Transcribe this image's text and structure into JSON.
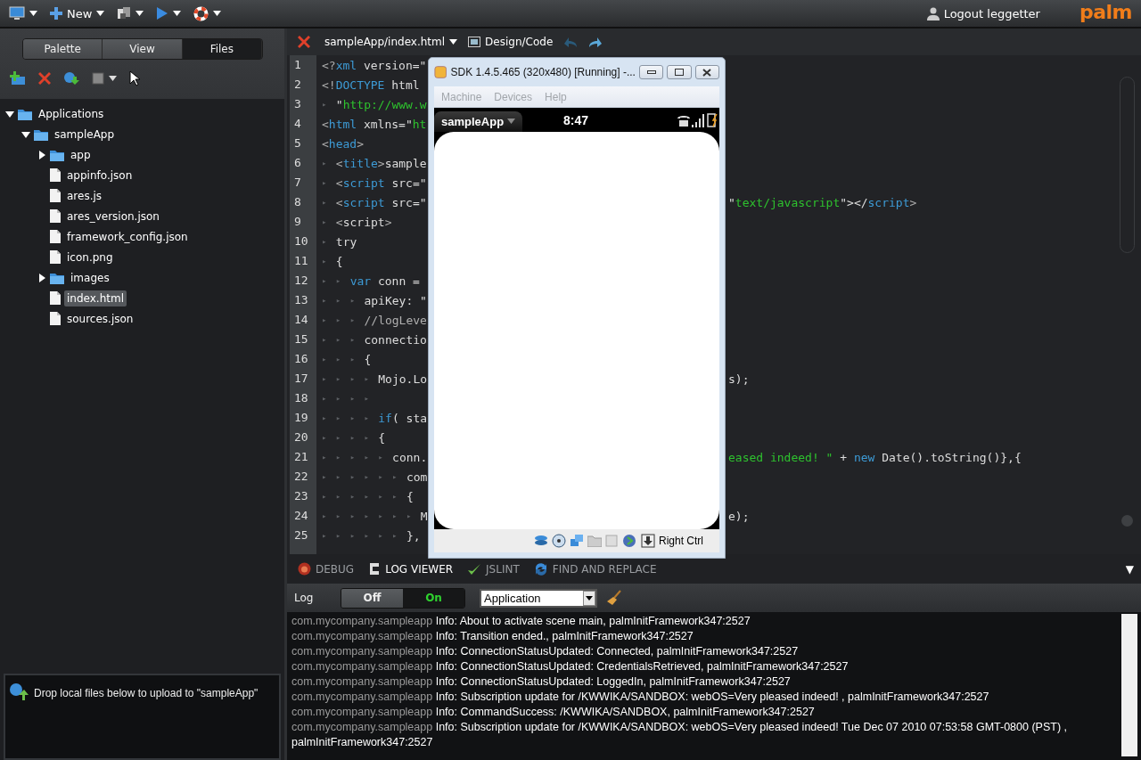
{
  "toolbar": {
    "new_label": "New",
    "user_label": "Logout leggetter",
    "logo": "palm"
  },
  "sidebar": {
    "tabs": [
      {
        "label": "Palette",
        "selected": false
      },
      {
        "label": "View",
        "selected": false
      },
      {
        "label": "Files",
        "selected": true
      }
    ],
    "tree": [
      {
        "label": "Applications",
        "kind": "folder",
        "expanded": true,
        "selected": false,
        "children": [
          {
            "label": "sampleApp",
            "kind": "folder",
            "expanded": true,
            "selected": false,
            "children": [
              {
                "label": "app",
                "kind": "folder",
                "expanded": false,
                "selected": false
              },
              {
                "label": "appinfo.json",
                "kind": "file",
                "selected": false
              },
              {
                "label": "ares.js",
                "kind": "file",
                "selected": false
              },
              {
                "label": "ares_version.json",
                "kind": "file",
                "selected": false
              },
              {
                "label": "framework_config.json",
                "kind": "file",
                "selected": false
              },
              {
                "label": "icon.png",
                "kind": "file",
                "selected": false
              },
              {
                "label": "images",
                "kind": "folder",
                "expanded": false,
                "selected": false
              },
              {
                "label": "index.html",
                "kind": "file",
                "selected": true
              },
              {
                "label": "sources.json",
                "kind": "file",
                "selected": false
              }
            ]
          }
        ]
      }
    ],
    "upload_hint": "Drop local files below to upload to \"sampleApp\""
  },
  "editor": {
    "file_tab": "sampleApp/index.html",
    "mode_label": "Design/Code",
    "lines": [
      {
        "number": "1",
        "left": [
          {
            "kind": "punct",
            "t": "<?"
          },
          {
            "kind": "tag",
            "t": "xml"
          },
          {
            "kind": "plain",
            "t": " version=\""
          }
        ]
      },
      {
        "number": "2",
        "left": [
          {
            "kind": "punct",
            "t": "<!"
          },
          {
            "kind": "tag",
            "t": "DOCTYPE"
          },
          {
            "kind": "plain",
            "t": " html"
          }
        ]
      },
      {
        "number": "3",
        "indent": "▸",
        "left": [
          {
            "kind": "plain",
            "t": "\""
          },
          {
            "kind": "string",
            "t": "http://www.w"
          }
        ]
      },
      {
        "number": "4",
        "left": [
          {
            "kind": "punct",
            "t": "<"
          },
          {
            "kind": "tag",
            "t": "html"
          },
          {
            "kind": "plain",
            "t": " xmlns=\""
          },
          {
            "kind": "string",
            "t": "ht"
          }
        ]
      },
      {
        "number": "5",
        "left": [
          {
            "kind": "punct",
            "t": "<"
          },
          {
            "kind": "tag",
            "t": "head"
          },
          {
            "kind": "punct",
            "t": ">"
          }
        ]
      },
      {
        "number": "6",
        "indent": "▸",
        "left": [
          {
            "kind": "punct",
            "t": "<"
          },
          {
            "kind": "tag",
            "t": "title"
          },
          {
            "kind": "punct",
            "t": ">"
          },
          {
            "kind": "plain",
            "t": "sample"
          }
        ]
      },
      {
        "number": "7",
        "indent": "▸",
        "left": [
          {
            "kind": "punct",
            "t": "<"
          },
          {
            "kind": "tag",
            "t": "script"
          },
          {
            "kind": "plain",
            "t": " src=\""
          }
        ]
      },
      {
        "number": "8",
        "indent": "▸",
        "left": [
          {
            "kind": "punct",
            "t": "<"
          },
          {
            "kind": "tag",
            "t": "script"
          },
          {
            "kind": "plain",
            "t": " src=\""
          }
        ],
        "right": [
          {
            "kind": "plain",
            "t": "\""
          },
          {
            "kind": "string",
            "t": "text/javascript"
          },
          {
            "kind": "plain",
            "t": "\"></"
          },
          {
            "kind": "tag",
            "t": "script"
          },
          {
            "kind": "punct",
            "t": ">"
          }
        ]
      },
      {
        "number": "9",
        "indent": "▸",
        "left": [
          {
            "kind": "punct",
            "t": "<"
          },
          {
            "kind": "plain",
            "t": "script"
          },
          {
            "kind": "punct",
            "t": ">"
          }
        ]
      },
      {
        "number": "10",
        "indent": "▸",
        "left": [
          {
            "kind": "plain",
            "t": "try"
          }
        ]
      },
      {
        "number": "11",
        "indent": "▸",
        "left": [
          {
            "kind": "plain",
            "t": "{"
          }
        ]
      },
      {
        "number": "12",
        "indent": "▸▸",
        "left": [
          {
            "kind": "keyword",
            "t": "var"
          },
          {
            "kind": "plain",
            "t": " conn ="
          }
        ]
      },
      {
        "number": "13",
        "indent": "▸▸▸",
        "left": [
          {
            "kind": "plain",
            "t": "apiKey: \""
          }
        ]
      },
      {
        "number": "14",
        "indent": "▸▸▸",
        "left": [
          {
            "kind": "comment",
            "t": "//logLeve"
          }
        ]
      },
      {
        "number": "15",
        "indent": "▸▸▸",
        "left": [
          {
            "kind": "plain",
            "t": "connectio"
          }
        ]
      },
      {
        "number": "16",
        "indent": "▸▸▸",
        "left": [
          {
            "kind": "plain",
            "t": "{"
          }
        ]
      },
      {
        "number": "17",
        "indent": "▸▸▸▸",
        "left": [
          {
            "kind": "plain",
            "t": "Mojo.Lo"
          }
        ],
        "right": [
          {
            "kind": "plain",
            "t": "s);"
          }
        ]
      },
      {
        "number": "18",
        "indent": "▸▸▸▸"
      },
      {
        "number": "19",
        "indent": "▸▸▸▸",
        "left": [
          {
            "kind": "keyword",
            "t": "if"
          },
          {
            "kind": "plain",
            "t": "( sta"
          }
        ]
      },
      {
        "number": "20",
        "indent": "▸▸▸▸",
        "left": [
          {
            "kind": "plain",
            "t": "{"
          }
        ]
      },
      {
        "number": "21",
        "indent": "▸▸▸▸▸",
        "left": [
          {
            "kind": "plain",
            "t": "conn."
          }
        ],
        "right": [
          {
            "kind": "string",
            "t": "eased indeed! \""
          },
          {
            "kind": "plain",
            "t": " + "
          },
          {
            "kind": "keyword",
            "t": "new"
          },
          {
            "kind": "plain",
            "t": " Date().toString()},{"
          }
        ]
      },
      {
        "number": "22",
        "indent": "▸▸▸▸▸▸",
        "left": [
          {
            "kind": "plain",
            "t": "com"
          }
        ]
      },
      {
        "number": "23",
        "indent": "▸▸▸▸▸▸",
        "left": [
          {
            "kind": "plain",
            "t": "{"
          }
        ]
      },
      {
        "number": "24",
        "indent": "▸▸▸▸▸▸▸",
        "left": [
          {
            "kind": "plain",
            "t": "M"
          }
        ],
        "right": [
          {
            "kind": "plain",
            "t": "e);"
          }
        ]
      },
      {
        "number": "25",
        "indent": "▸▸▸▸▸▸",
        "left": [
          {
            "kind": "plain",
            "t": "},"
          }
        ]
      }
    ]
  },
  "emulator": {
    "title": "SDK 1.4.5.465 (320x480) [Running] -...",
    "menu": [
      {
        "label": "Machine",
        "disabled": true
      },
      {
        "label": "Devices",
        "disabled": true
      },
      {
        "label": "Help",
        "disabled": true
      }
    ],
    "app_name": "sampleApp",
    "time": "8:47",
    "host_key": "Right Ctrl"
  },
  "panel": {
    "tabs": [
      {
        "label": "DEBUG",
        "selected": false
      },
      {
        "label": "LOG VIEWER",
        "selected": true
      },
      {
        "label": "JSLINT",
        "selected": false
      },
      {
        "label": "FIND AND REPLACE",
        "selected": false
      }
    ],
    "collapse": "▼",
    "log": {
      "label": "Log",
      "toggle": [
        {
          "label": "Off",
          "selected": false
        },
        {
          "label": "On",
          "selected": true
        }
      ],
      "filter": "Application",
      "entries": [
        {
          "source": "com.mycompany.sampleapp",
          "message": "Info: About to activate scene  main, palmInitFramework347:2527"
        },
        {
          "source": "com.mycompany.sampleapp",
          "message": "Info: Transition ended., palmInitFramework347:2527"
        },
        {
          "source": "com.mycompany.sampleapp",
          "message": "Info: ConnectionStatusUpdated: Connected, palmInitFramework347:2527"
        },
        {
          "source": "com.mycompany.sampleapp",
          "message": "Info: ConnectionStatusUpdated: CredentialsRetrieved, palmInitFramework347:2527"
        },
        {
          "source": "com.mycompany.sampleapp",
          "message": "Info: ConnectionStatusUpdated: LoggedIn, palmInitFramework347:2527"
        },
        {
          "source": "com.mycompany.sampleapp",
          "message": "Info: Subscription update for /KWWIKA/SANDBOX: webOS=Very pleased indeed! , palmInitFramework347:2527"
        },
        {
          "source": "com.mycompany.sampleapp",
          "message": "Info: CommandSuccess: /KWWIKA/SANDBOX, palmInitFramework347:2527"
        },
        {
          "source": "com.mycompany.sampleapp",
          "message": "Info: Subscription update for /KWWIKA/SANDBOX: webOS=Very pleased indeed! Tue Dec 07 2010 07:53:58 GMT-0800 (PST) , palmInitFramework347:2527"
        }
      ]
    }
  }
}
